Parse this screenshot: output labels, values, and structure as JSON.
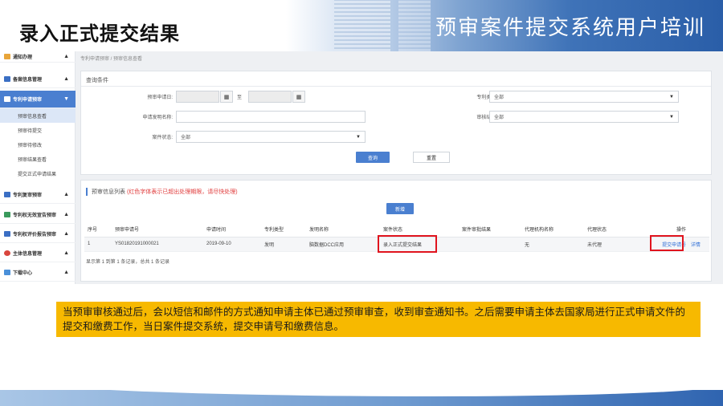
{
  "slide": {
    "title": "录入正式提交结果",
    "banner_text": "预审案件提交系统用户培训"
  },
  "sidebar": {
    "items": [
      {
        "label": "通知办理",
        "icon": "bell-icon",
        "arrow": "▲"
      },
      {
        "label": "备案信息管理",
        "icon": "folder-icon",
        "arrow": "▲"
      },
      {
        "label": "专利申请预审",
        "icon": "document-icon",
        "arrow": "▼"
      },
      {
        "label": "专利复审预审",
        "icon": "folder-icon",
        "arrow": "▲"
      },
      {
        "label": "专利权无效宣告预审",
        "icon": "document-icon",
        "arrow": "▲"
      },
      {
        "label": "专利权评价报告预审",
        "icon": "folder-icon",
        "arrow": "▲"
      },
      {
        "label": "主体信息管理",
        "icon": "user-icon",
        "arrow": "▲"
      },
      {
        "label": "下载中心",
        "icon": "download-icon",
        "arrow": "▲"
      }
    ],
    "subitems": [
      "预审信息查看",
      "预审待提交",
      "预审待修改",
      "预审结果查看",
      "提交正式申请结果"
    ]
  },
  "main": {
    "breadcrumb": "专利申请预审 / 预审信息查看",
    "query": {
      "header": "查询条件",
      "date_label": "预审申请日:",
      "date_sep": "至",
      "name_label": "申请发明名称:",
      "status_label": "案件状态:",
      "status_value": "全部",
      "type_label": "专利类型:",
      "type_value": "全部",
      "review_label": "审核结果:",
      "review_value": "全部",
      "search_button": "查询",
      "reset_button": "重置"
    },
    "list": {
      "title": "预审信息列表",
      "warning": "(红色字体表示已超出处理期限，请尽快处理)",
      "new_button": "新增",
      "columns": [
        "序号",
        "预审申请号",
        "申请时间",
        "专利类型",
        "发明名称",
        "案件状态",
        "案件审批结果",
        "代理机构名称",
        "代理状态",
        "操作"
      ],
      "rows": [
        {
          "index": "1",
          "app_no": "YS01820191000021",
          "date": "2019-09-10",
          "type": "发明",
          "name": "脑数据DCC应用",
          "status": "录入正式提交结果",
          "result": "",
          "agency": "无",
          "agent_status": "未代理",
          "action_submit": "提交申请号",
          "action_detail": "详情"
        }
      ],
      "pager": "显示第 1 到第 1 条记录，总共 1 条记录"
    }
  },
  "caption": "当预审审核通过后，会以短信和邮件的方式通知申请主体已通过预审审查，收到审查通知书。之后需要申请主体去国家局进行正式申请文件的提交和缴费工作，当日案件提交系统，提交申请号和缴费信息。",
  "colors": {
    "accent": "#4a7fd0",
    "highlight_box": "#e0141e",
    "caption_bg": "#f7b900",
    "warning_text": "#e03b3b"
  }
}
